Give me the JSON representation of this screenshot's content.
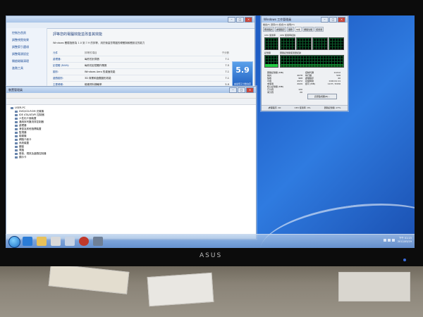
{
  "monitor": {
    "brand": "ASUS"
  },
  "perf_window": {
    "title": "",
    "sidebar": [
      {
        "label": "控制台首頁"
      },
      {
        "label": "調整視覺效果"
      },
      {
        "label": "調整索引選項"
      },
      {
        "label": "調整電源設定"
      },
      {
        "label": "開啟磁碟清理"
      },
      {
        "label": "進階工具"
      }
    ],
    "heading": "評等您的電腦效能並改善其效能",
    "subtitle": "Windows 體驗指數為 1.0 到 7.9 的評等，用於衡量您電腦的硬體與軟體設定的能力",
    "table": {
      "headers": [
        "元件",
        "評等的項目",
        "子分數"
      ],
      "rows": [
        {
          "component": "處理器:",
          "rated": "每秒的計算數",
          "score": "7.1"
        },
        {
          "component": "記憶體 (RAM):",
          "rated": "每秒的記憶體作業數",
          "score": "7.5"
        },
        {
          "component": "圖形:",
          "rated": "Windows Aero 的桌面效能",
          "score": "7.1"
        },
        {
          "component": "遊戲圖形:",
          "rated": "3D 商業和遊戲圖形效能",
          "score": "7.1"
        },
        {
          "component": "主要硬碟:",
          "rated": "磁碟資料傳輸率",
          "score": "5.9"
        }
      ]
    },
    "base_score": {
      "value": "5.9",
      "caption": "由最低子分數決定"
    }
  },
  "device_manager": {
    "title": "裝置管理員",
    "tree": [
      {
        "label": "USER-PC",
        "level": 0
      },
      {
        "label": "DVD/CD-ROM 光碟機",
        "level": 1
      },
      {
        "label": "IDE ATA/ATAPI 控制器",
        "level": 1
      },
      {
        "label": "人性化介面裝置",
        "level": 1
      },
      {
        "label": "通用序列匯流排控制器",
        "level": 1
      },
      {
        "label": "處理器",
        "level": 1
      },
      {
        "label": "滑鼠及其他指標裝置",
        "level": 1
      },
      {
        "label": "監視器",
        "level": 1
      },
      {
        "label": "磁碟機",
        "level": 1
      },
      {
        "label": "網路介面卡",
        "level": 1
      },
      {
        "label": "系統裝置",
        "level": 1
      },
      {
        "label": "鍵盤",
        "level": 1
      },
      {
        "label": "電腦",
        "level": 1
      },
      {
        "label": "聲音、視訊及遊戲控制器",
        "level": 1
      },
      {
        "label": "顯示卡",
        "level": 1
      }
    ]
  },
  "task_manager": {
    "title": "Windows 工作管理員",
    "menu": "檔案(F)  選項(O)  檢視(V)  說明(H)",
    "tabs": [
      "應用程式",
      "處理程序",
      "服務",
      "效能",
      "網路功能",
      "使用者"
    ],
    "active_tab": "效能",
    "labels": {
      "cpu_usage": "CPU 使用率",
      "cpu_history": "CPU 使用率紀錄",
      "memory": "記憶體",
      "memory_history": "實體記憶體使用量紀錄"
    },
    "cpu_usage_percent": 0,
    "memory_usage_fraction": 0.27,
    "stats": [
      {
        "label": "實體記憶體 (MB)",
        "value": ""
      },
      {
        "label": "總共",
        "value": "4078"
      },
      {
        "label": "快取",
        "value": "968"
      },
      {
        "label": "可用",
        "value": "2972"
      },
      {
        "label": "未使用",
        "value": "2029"
      },
      {
        "label": "核心記憶體 (MB)",
        "value": ""
      },
      {
        "label": "已分頁",
        "value": "120"
      },
      {
        "label": "未分頁",
        "value": "26"
      }
    ],
    "system_stats": [
      {
        "label": "控制代碼",
        "value": "11212"
      },
      {
        "label": "執行緒",
        "value": "526"
      },
      {
        "label": "處理程序",
        "value": "40"
      },
      {
        "label": "存留時間",
        "value": "0:00:01:11"
      },
      {
        "label": "認可 (MB)",
        "value": "1137 / 8156"
      }
    ],
    "resource_monitor_button": "資源監視器(R)...",
    "status": {
      "processes": "處理程序: 40",
      "cpu": "CPU 使用率: 0%",
      "memory": "實體記憶體: 27%"
    }
  },
  "taskbar": {
    "clock_time": "下午 01:15",
    "clock_date": "2012/03/19"
  }
}
